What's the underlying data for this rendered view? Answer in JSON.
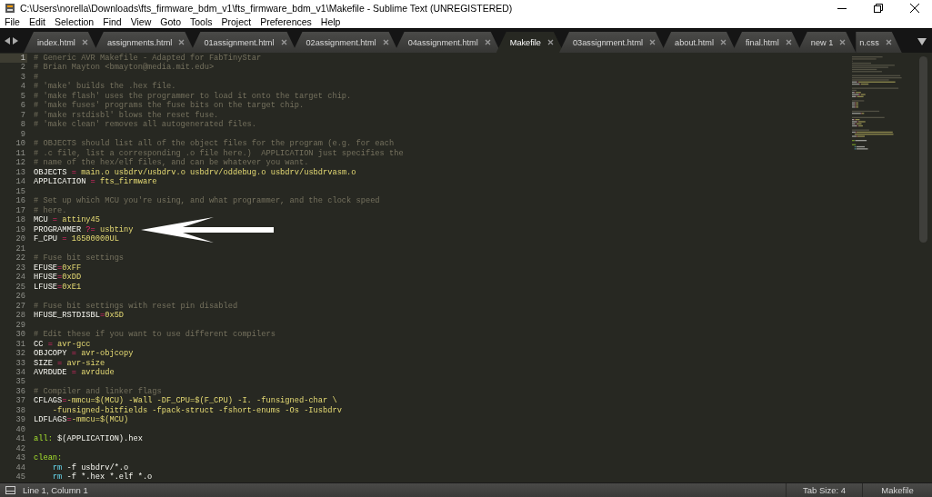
{
  "window": {
    "title": "C:\\Users\\norella\\Downloads\\fts_firmware_bdm_v1\\fts_firmware_bdm_v1\\Makefile - Sublime Text (UNREGISTERED)"
  },
  "menu": [
    "File",
    "Edit",
    "Selection",
    "Find",
    "View",
    "Goto",
    "Tools",
    "Project",
    "Preferences",
    "Help"
  ],
  "tabs": [
    {
      "label": "index.html",
      "selected": false
    },
    {
      "label": "assignments.html",
      "selected": false
    },
    {
      "label": "01assignment.html",
      "selected": false
    },
    {
      "label": "02assignment.html",
      "selected": false
    },
    {
      "label": "04assignment.html",
      "selected": false
    },
    {
      "label": "Makefile",
      "selected": true
    },
    {
      "label": "03assignment.html",
      "selected": false
    },
    {
      "label": "about.html",
      "selected": false
    },
    {
      "label": "final.html",
      "selected": false
    },
    {
      "label": "new 1",
      "selected": false
    },
    {
      "label": "n.css",
      "selected": false
    }
  ],
  "editor": {
    "lines": [
      {
        "n": "1",
        "current": true,
        "tokens": [
          {
            "kind": "comment",
            "text": "# Generic AVR Makefile - Adapted for FabTinyStar"
          }
        ]
      },
      {
        "n": "2",
        "tokens": [
          {
            "kind": "comment",
            "text": "# Brian Mayton <bmayton@media.mit.edu>"
          }
        ]
      },
      {
        "n": "3",
        "tokens": [
          {
            "kind": "comment",
            "text": "#"
          }
        ]
      },
      {
        "n": "4",
        "tokens": [
          {
            "kind": "comment",
            "text": "# 'make' builds the .hex file."
          }
        ]
      },
      {
        "n": "5",
        "tokens": [
          {
            "kind": "comment",
            "text": "# 'make flash' uses the programmer to load it onto the target chip."
          }
        ]
      },
      {
        "n": "6",
        "tokens": [
          {
            "kind": "comment",
            "text": "# 'make fuses' programs the fuse bits on the target chip."
          }
        ]
      },
      {
        "n": "7",
        "tokens": [
          {
            "kind": "comment",
            "text": "# 'make rstdisbl' blows the reset fuse."
          }
        ]
      },
      {
        "n": "8",
        "tokens": [
          {
            "kind": "comment",
            "text": "# 'make clean' removes all autogenerated files."
          }
        ]
      },
      {
        "n": "9"
      },
      {
        "n": "10",
        "tokens": [
          {
            "kind": "comment",
            "text": "# OBJECTS should list all of the object files for the program (e.g. for each"
          }
        ]
      },
      {
        "n": "11",
        "tokens": [
          {
            "kind": "comment",
            "text": "# .c file, list a corresponding .o file here.)  APPLICATION just specifies the"
          }
        ]
      },
      {
        "n": "12",
        "tokens": [
          {
            "kind": "comment",
            "text": "# name of the hex/elf files, and can be whatever you want."
          }
        ]
      },
      {
        "n": "13",
        "tokens": [
          {
            "kind": "var",
            "text": "OBJECTS "
          },
          {
            "kind": "op",
            "text": "="
          },
          {
            "kind": "value",
            "text": " main.o usbdrv/usbdrv.o usbdrv/oddebug.o usbdrv/usbdrvasm.o"
          }
        ]
      },
      {
        "n": "14",
        "tokens": [
          {
            "kind": "var",
            "text": "APPLICATION "
          },
          {
            "kind": "op",
            "text": "="
          },
          {
            "kind": "value",
            "text": " fts_firmware"
          }
        ]
      },
      {
        "n": "15"
      },
      {
        "n": "16",
        "tokens": [
          {
            "kind": "comment",
            "text": "# Set up which MCU you're using, and what programmer, and the clock speed"
          }
        ]
      },
      {
        "n": "17",
        "tokens": [
          {
            "kind": "comment",
            "text": "# here."
          }
        ]
      },
      {
        "n": "18",
        "tokens": [
          {
            "kind": "var",
            "text": "MCU "
          },
          {
            "kind": "op",
            "text": "="
          },
          {
            "kind": "value",
            "text": " attiny45"
          }
        ]
      },
      {
        "n": "19",
        "arrow": true,
        "tokens": [
          {
            "kind": "var",
            "text": "PROGRAMMER "
          },
          {
            "kind": "op",
            "text": "?="
          },
          {
            "kind": "value",
            "text": " usbtiny"
          }
        ]
      },
      {
        "n": "20",
        "tokens": [
          {
            "kind": "var",
            "text": "F_CPU "
          },
          {
            "kind": "op",
            "text": "="
          },
          {
            "kind": "value",
            "text": " 16500000UL"
          }
        ]
      },
      {
        "n": "21"
      },
      {
        "n": "22",
        "tokens": [
          {
            "kind": "comment",
            "text": "# Fuse bit settings"
          }
        ]
      },
      {
        "n": "23",
        "tokens": [
          {
            "kind": "var",
            "text": "EFUSE"
          },
          {
            "kind": "op",
            "text": "="
          },
          {
            "kind": "value",
            "text": "0xFF"
          }
        ]
      },
      {
        "n": "24",
        "tokens": [
          {
            "kind": "var",
            "text": "HFUSE"
          },
          {
            "kind": "op",
            "text": "="
          },
          {
            "kind": "value",
            "text": "0xDD"
          }
        ]
      },
      {
        "n": "25",
        "tokens": [
          {
            "kind": "var",
            "text": "LFUSE"
          },
          {
            "kind": "op",
            "text": "="
          },
          {
            "kind": "value",
            "text": "0xE1"
          }
        ]
      },
      {
        "n": "26"
      },
      {
        "n": "27",
        "tokens": [
          {
            "kind": "comment",
            "text": "# Fuse bit settings with reset pin disabled"
          }
        ]
      },
      {
        "n": "28",
        "tokens": [
          {
            "kind": "var",
            "text": "HFUSE_RSTDISBL"
          },
          {
            "kind": "op",
            "text": "="
          },
          {
            "kind": "value",
            "text": "0x5D"
          }
        ]
      },
      {
        "n": "29"
      },
      {
        "n": "30",
        "tokens": [
          {
            "kind": "comment",
            "text": "# Edit these if you want to use different compilers"
          }
        ]
      },
      {
        "n": "31",
        "tokens": [
          {
            "kind": "var",
            "text": "CC "
          },
          {
            "kind": "op",
            "text": "="
          },
          {
            "kind": "value",
            "text": " avr-gcc"
          }
        ]
      },
      {
        "n": "32",
        "tokens": [
          {
            "kind": "var",
            "text": "OBJCOPY "
          },
          {
            "kind": "op",
            "text": "="
          },
          {
            "kind": "value",
            "text": " avr-objcopy"
          }
        ]
      },
      {
        "n": "33",
        "tokens": [
          {
            "kind": "var",
            "text": "SIZE "
          },
          {
            "kind": "op",
            "text": "="
          },
          {
            "kind": "value",
            "text": " avr-size"
          }
        ]
      },
      {
        "n": "34",
        "tokens": [
          {
            "kind": "var",
            "text": "AVRDUDE "
          },
          {
            "kind": "op",
            "text": "="
          },
          {
            "kind": "value",
            "text": " avrdude"
          }
        ]
      },
      {
        "n": "35"
      },
      {
        "n": "36",
        "tokens": [
          {
            "kind": "comment",
            "text": "# Compiler and linker flags"
          }
        ]
      },
      {
        "n": "37",
        "tokens": [
          {
            "kind": "var",
            "text": "CFLAGS"
          },
          {
            "kind": "op",
            "text": "="
          },
          {
            "kind": "value",
            "text": "-mmcu=$(MCU) -Wall -DF_CPU=$(F_CPU) -I. -funsigned-char \\"
          }
        ]
      },
      {
        "n": "38",
        "tokens": [
          {
            "kind": "value",
            "text": "    -funsigned-bitfields -fpack-struct -fshort-enums -Os -Iusbdrv"
          }
        ]
      },
      {
        "n": "39",
        "tokens": [
          {
            "kind": "var",
            "text": "LDFLAGS"
          },
          {
            "kind": "op",
            "text": "="
          },
          {
            "kind": "value",
            "text": "-mmcu=$(MCU)"
          }
        ]
      },
      {
        "n": "40"
      },
      {
        "n": "41",
        "tokens": [
          {
            "kind": "target",
            "text": "all:"
          },
          {
            "kind": "plain",
            "text": " $(APPLICATION).hex"
          }
        ]
      },
      {
        "n": "42"
      },
      {
        "n": "43",
        "tokens": [
          {
            "kind": "target",
            "text": "clean:"
          }
        ]
      },
      {
        "n": "44",
        "tokens": [
          {
            "kind": "command",
            "text": "    rm"
          },
          {
            "kind": "plain",
            "text": " -f usbdrv/*.o"
          }
        ]
      },
      {
        "n": "45",
        "tokens": [
          {
            "kind": "command",
            "text": "    rm"
          },
          {
            "kind": "plain",
            "text": " -f *.hex *.elf *.o"
          }
        ]
      }
    ]
  },
  "status_bar": {
    "position": "Line 1, Column 1",
    "tab_size": "Tab Size: 4",
    "syntax": "Makefile"
  }
}
